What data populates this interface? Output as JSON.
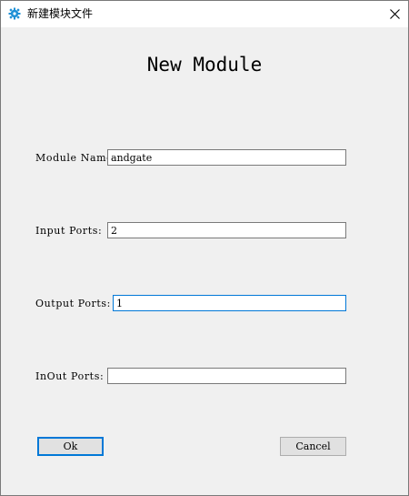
{
  "window": {
    "title": "新建模块文件",
    "app_icon": "gear-icon",
    "close_icon": "close-icon"
  },
  "heading": "New Module",
  "form": {
    "module_name": {
      "label": "Module Name:",
      "value": "andgate"
    },
    "input_ports": {
      "label": "Input Ports:",
      "value": "2"
    },
    "output_ports": {
      "label": "Output Ports:",
      "value": "1"
    },
    "inout_ports": {
      "label": "InOut Ports:",
      "value": ""
    }
  },
  "buttons": {
    "ok": "Ok",
    "cancel": "Cancel"
  },
  "colors": {
    "focus_border": "#0078d7",
    "window_bg": "#f0f0f0",
    "icon_blue": "#1e90d6"
  }
}
